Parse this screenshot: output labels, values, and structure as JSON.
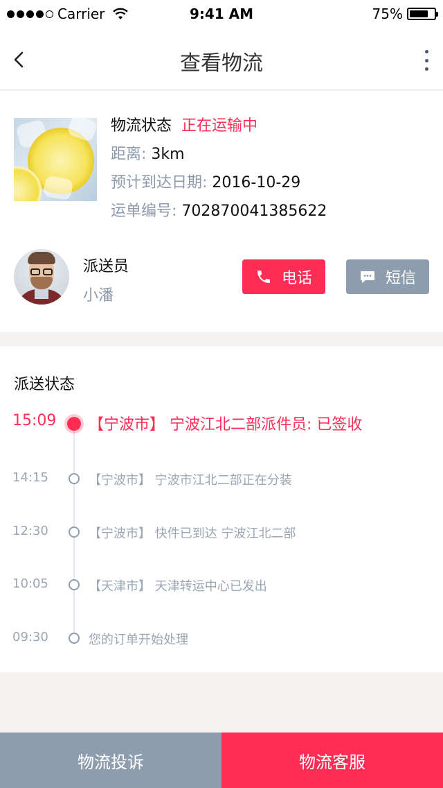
{
  "status_bar": {
    "carrier": "Carrier",
    "time": "9:41 AM",
    "battery": "75%",
    "battery_level": 0.75
  },
  "nav": {
    "title": "查看物流"
  },
  "package": {
    "status_label": "物流状态",
    "status_value": "正在运输中",
    "distance_label": "距离:",
    "distance_value": "3km",
    "eta_label": "预计到达日期:",
    "eta_value": "2016-10-29",
    "tracking_label": "运单编号:",
    "tracking_value": "702870041385622"
  },
  "courier": {
    "role": "派送员",
    "name": "小潘",
    "call_label": "电话",
    "sms_label": "短信"
  },
  "timeline": {
    "title": "派送状态",
    "items": [
      {
        "time": "15:09",
        "text": "【宁波市】 宁波江北二部派件员: 已签收",
        "active": true
      },
      {
        "time": "14:15",
        "text": "【宁波市】 宁波市江北二部正在分装",
        "active": false
      },
      {
        "time": "12:30",
        "text": "【宁波市】 快件已到达 宁波江北二部",
        "active": false
      },
      {
        "time": "10:05",
        "text": "【天津市】 天津转运中心已发出",
        "active": false
      },
      {
        "time": "09:30",
        "text": "您的订单开始处理",
        "active": false
      }
    ]
  },
  "bottom": {
    "complaint_label": "物流投诉",
    "service_label": "物流客服"
  },
  "colors": {
    "accent": "#ff2d55",
    "muted": "#8e9dae",
    "background": "#f5f2f1"
  },
  "icons": {
    "back": "chevron-left-icon",
    "more": "more-vertical-icon",
    "call": "phone-icon",
    "sms": "message-icon"
  }
}
